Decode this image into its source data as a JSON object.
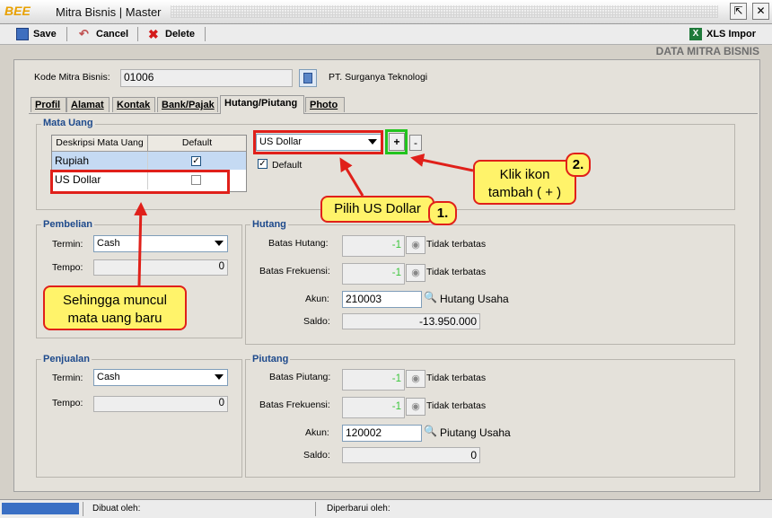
{
  "window": {
    "logo": "BEE",
    "title": "Mitra Bisnis | Master",
    "restore_glyph": "⇱",
    "close_glyph": "✕"
  },
  "toolbar": {
    "save_label": "Save",
    "cancel_label": "Cancel",
    "delete_label": "Delete",
    "xls_label": "XLS Impor",
    "xls_icon_text": "X"
  },
  "header": {
    "section_title": "DATA MITRA BISNIS"
  },
  "form": {
    "kode_label": "Kode Mitra Bisnis:",
    "kode_value": "01006",
    "company_name": "PT. Surganya Teknologi"
  },
  "tabs": [
    "Profil",
    "Alamat",
    "Kontak",
    "Bank/Pajak",
    "Hutang/Piutang",
    "Photo"
  ],
  "mata_uang": {
    "title": "Mata Uang",
    "columns": [
      "Deskripsi Mata Uang",
      "Default"
    ],
    "rows": [
      {
        "desc": "Rupiah",
        "default_mark": "✓"
      },
      {
        "desc": "US Dollar",
        "default_mark": ""
      }
    ],
    "select_value": "US Dollar",
    "add_label": "+",
    "remove_label": "-",
    "default_label": "Default",
    "default_check_mark": "✓"
  },
  "pembelian": {
    "title": "Pembelian",
    "termin_label": "Termin:",
    "termin_value": "Cash",
    "tempo_label": "Tempo:",
    "tempo_value": "0"
  },
  "penjualan": {
    "title": "Penjualan",
    "termin_label": "Termin:",
    "termin_value": "Cash",
    "tempo_label": "Tempo:",
    "tempo_value": "0"
  },
  "hutang": {
    "title": "Hutang",
    "batas_label": "Batas Hutang:",
    "batas_value": "-1",
    "batas_note": "Tidak terbatas",
    "frek_label": "Batas Frekuensi:",
    "frek_value": "-1",
    "frek_note": "Tidak terbatas",
    "akun_label": "Akun:",
    "akun_value": "210003",
    "akun_name": "Hutang Usaha",
    "saldo_label": "Saldo:",
    "saldo_value": "-13.950.000"
  },
  "piutang": {
    "title": "Piutang",
    "batas_label": "Batas Piutang:",
    "batas_value": "-1",
    "batas_note": "Tidak terbatas",
    "frek_label": "Batas Frekuensi:",
    "frek_value": "-1",
    "frek_note": "Tidak terbatas",
    "akun_label": "Akun:",
    "akun_value": "120002",
    "akun_name": "Piutang Usaha",
    "saldo_label": "Saldo:",
    "saldo_value": "0"
  },
  "annotations": {
    "pilih": "Pilih US Dollar",
    "pilih_num": "1.",
    "klik_line1": "Klik ikon",
    "klik_line2": "tambah ( + )",
    "klik_num": "2.",
    "muncul_line1": "Sehingga muncul",
    "muncul_line2": "mata uang baru"
  },
  "statusbar": {
    "dibuat_label": "Dibuat oleh:",
    "diperbarui_label": "Diperbarui oleh:"
  },
  "colors": {
    "annotation_red": "#e0201a",
    "callout_yellow": "#fff36a",
    "highlight_green": "#22c41e",
    "group_title_blue": "#1e4a8c"
  }
}
